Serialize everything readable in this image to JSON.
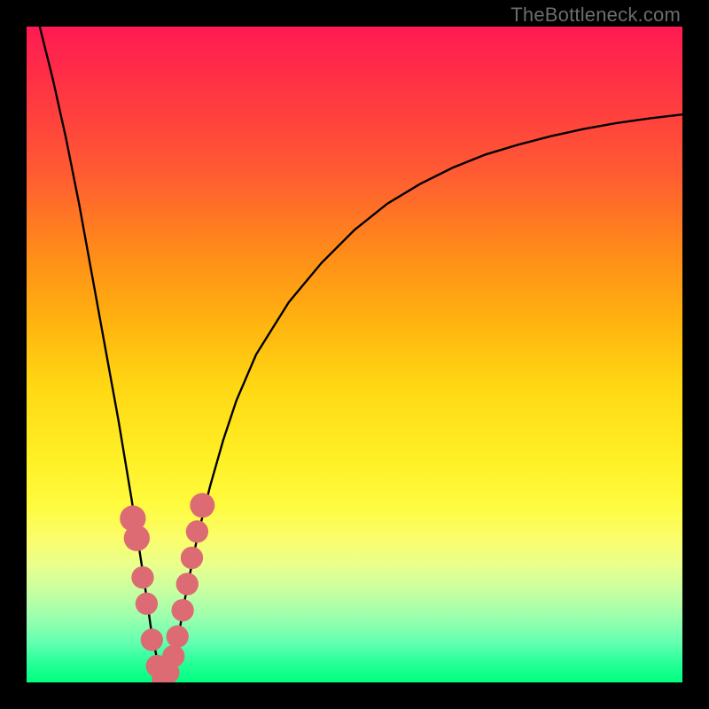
{
  "watermark": "TheBottleneck.com",
  "chart_data": {
    "type": "line",
    "title": "",
    "xlabel": "",
    "ylabel": "",
    "xlim": [
      0,
      100
    ],
    "ylim": [
      0,
      100
    ],
    "grid": false,
    "legend": false,
    "axes_hidden": true,
    "background": "red-yellow-green vertical gradient",
    "series": [
      {
        "name": "bottleneck-curve",
        "color": "#000000",
        "x": [
          2,
          4,
          6,
          8,
          10,
          12,
          14,
          16,
          18,
          19,
          20,
          21,
          22,
          23,
          24,
          26,
          28,
          30,
          32,
          35,
          40,
          45,
          50,
          55,
          60,
          65,
          70,
          75,
          80,
          85,
          90,
          95,
          100
        ],
        "values": [
          100,
          92,
          83,
          73,
          62,
          51,
          40,
          28,
          15,
          8,
          3,
          0,
          2,
          6,
          12,
          22,
          30,
          37,
          43,
          50,
          58,
          64,
          69,
          73,
          76,
          78.5,
          80.5,
          82,
          83.3,
          84.4,
          85.3,
          86,
          86.6
        ]
      }
    ],
    "markers": [
      {
        "x": 16.2,
        "y": 25.0,
        "r": 1.6
      },
      {
        "x": 16.8,
        "y": 22.0,
        "r": 1.6
      },
      {
        "x": 17.7,
        "y": 16.0,
        "r": 1.3
      },
      {
        "x": 18.3,
        "y": 12.0,
        "r": 1.3
      },
      {
        "x": 19.1,
        "y": 6.5,
        "r": 1.3
      },
      {
        "x": 19.9,
        "y": 2.5,
        "r": 1.3
      },
      {
        "x": 20.8,
        "y": 0.5,
        "r": 1.3
      },
      {
        "x": 21.6,
        "y": 1.5,
        "r": 1.3
      },
      {
        "x": 22.4,
        "y": 4.0,
        "r": 1.3
      },
      {
        "x": 23.0,
        "y": 7.0,
        "r": 1.3
      },
      {
        "x": 23.8,
        "y": 11.0,
        "r": 1.3
      },
      {
        "x": 24.5,
        "y": 15.0,
        "r": 1.3
      },
      {
        "x": 25.2,
        "y": 19.0,
        "r": 1.3
      },
      {
        "x": 26.0,
        "y": 23.0,
        "r": 1.3
      },
      {
        "x": 26.8,
        "y": 27.0,
        "r": 1.5
      }
    ],
    "marker_color": "#dd6b74"
  }
}
